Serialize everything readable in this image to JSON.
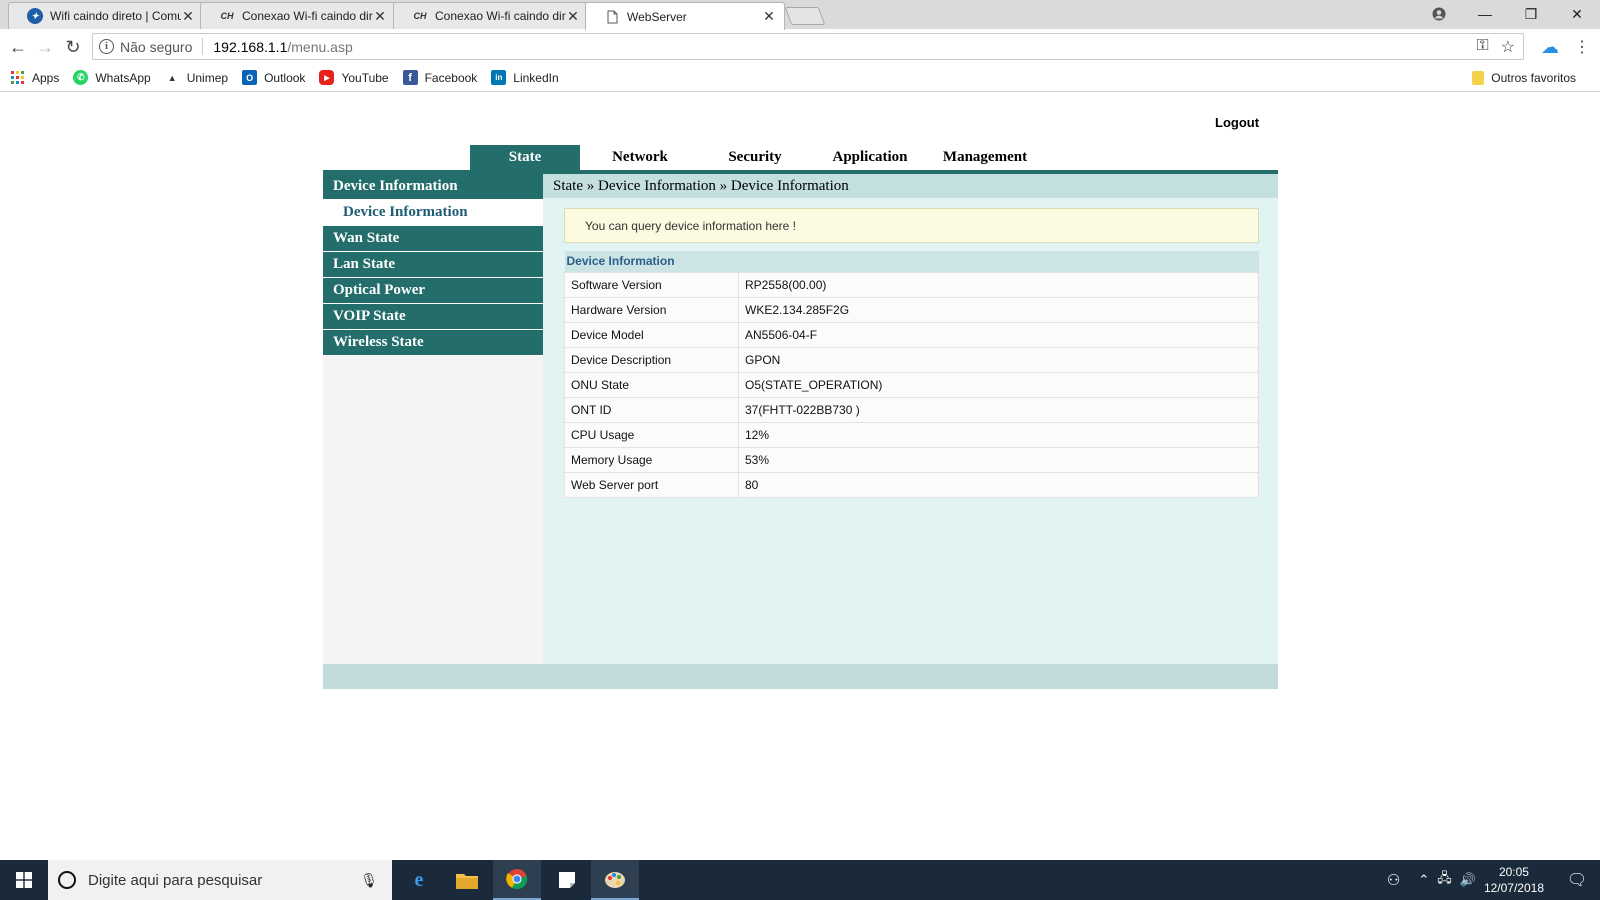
{
  "browser": {
    "tabs": [
      {
        "title": "Wifi caindo direto | Comu",
        "icon": "community-icon",
        "active": false
      },
      {
        "title": "Conexao Wi-fi caindo dir",
        "icon": "cl-site-icon",
        "active": false
      },
      {
        "title": "Conexao Wi-fi caindo dir",
        "icon": "cl-site-icon",
        "active": false
      },
      {
        "title": "WebServer",
        "icon": "page-icon",
        "active": true
      }
    ],
    "favicon_text": "CH",
    "address": {
      "security_label": "Não seguro",
      "host": "192.168.1.1",
      "path": "/menu.asp"
    },
    "bookmarks": [
      {
        "label": "Apps",
        "icon": "apps-grid-icon"
      },
      {
        "label": "WhatsApp",
        "icon": "whatsapp-icon",
        "color": "#25d366"
      },
      {
        "label": "Unimep",
        "icon": "unimep-icon"
      },
      {
        "label": "Outlook",
        "icon": "outlook-icon",
        "color": "#0a64b5"
      },
      {
        "label": "YouTube",
        "icon": "youtube-icon",
        "color": "#e62117"
      },
      {
        "label": "Facebook",
        "icon": "facebook-icon",
        "color": "#3b5998"
      },
      {
        "label": "LinkedIn",
        "icon": "linkedin-icon",
        "color": "#0077b5"
      }
    ],
    "other_bookmarks": "Outros favoritos"
  },
  "router": {
    "logout": "Logout",
    "top_nav": [
      "State",
      "Network",
      "Security",
      "Application",
      "Management"
    ],
    "active_tab": "State",
    "accent_color": "#236d6b",
    "sidebar": [
      {
        "label": "Device Information",
        "type": "section"
      },
      {
        "label": "Device Information",
        "type": "sub"
      },
      {
        "label": "Wan State",
        "type": "section"
      },
      {
        "label": "Lan State",
        "type": "section"
      },
      {
        "label": "Optical Power",
        "type": "section"
      },
      {
        "label": "VOIP State",
        "type": "section"
      },
      {
        "label": "Wireless State",
        "type": "section"
      }
    ],
    "breadcrumb": "State » Device Information » Device Information",
    "notice": "You can query device information here !",
    "table_title": "Device Information",
    "rows": [
      {
        "key": "Software Version",
        "value": "RP2558(00.00)"
      },
      {
        "key": "Hardware Version",
        "value": "WKE2.134.285F2G"
      },
      {
        "key": "Device Model",
        "value": "AN5506-04-F"
      },
      {
        "key": "Device Description",
        "value": "GPON"
      },
      {
        "key": "ONU State",
        "value": "O5(STATE_OPERATION)"
      },
      {
        "key": "ONT ID",
        "value": "37(FHTT-022BB730 )"
      },
      {
        "key": "CPU Usage",
        "value": "12%"
      },
      {
        "key": "Memory Usage",
        "value": "53%"
      },
      {
        "key": "Web Server port",
        "value": "80"
      }
    ]
  },
  "taskbar": {
    "search_placeholder": "Digite aqui para pesquisar",
    "time": "20:05",
    "date": "12/07/2018"
  }
}
